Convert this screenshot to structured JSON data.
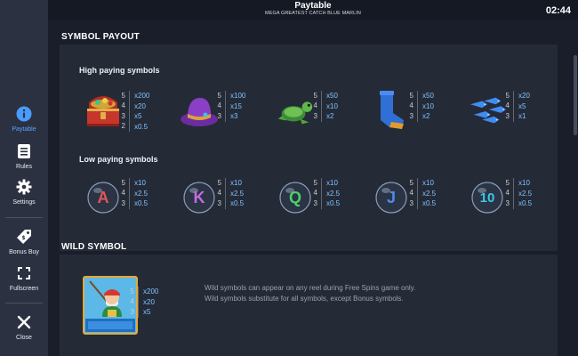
{
  "header": {
    "title": "Paytable",
    "subtitle": "MEGA GREATEST CATCH BLUE MARLIN",
    "clock": "02:44"
  },
  "sidebar": {
    "items": [
      {
        "label": "Paytable",
        "icon": "info-icon"
      },
      {
        "label": "Rules",
        "icon": "rules-icon"
      },
      {
        "label": "Settings",
        "icon": "gear-icon"
      },
      {
        "label": "Bonus Buy",
        "icon": "tag-icon"
      },
      {
        "label": "Fullscreen",
        "icon": "fullscreen-icon"
      },
      {
        "label": "Close",
        "icon": "close-icon"
      }
    ],
    "active_color": "#5aa6ff"
  },
  "symbol_payout": {
    "title": "SYMBOL PAYOUT",
    "high_title": "High paying symbols",
    "low_title": "Low paying symbols",
    "high": [
      {
        "icon": "treasure-chest-icon",
        "pays": [
          [
            "5",
            "x200"
          ],
          [
            "4",
            "x20"
          ],
          [
            "3",
            "x5"
          ],
          [
            "2",
            "x0.5"
          ]
        ]
      },
      {
        "icon": "fishing-hat-icon",
        "pays": [
          [
            "5",
            "x100"
          ],
          [
            "4",
            "x15"
          ],
          [
            "3",
            "x3"
          ]
        ]
      },
      {
        "icon": "turtle-icon",
        "pays": [
          [
            "5",
            "x50"
          ],
          [
            "4",
            "x10"
          ],
          [
            "3",
            "x2"
          ]
        ]
      },
      {
        "icon": "rubber-boot-icon",
        "pays": [
          [
            "5",
            "x50"
          ],
          [
            "4",
            "x10"
          ],
          [
            "3",
            "x2"
          ]
        ]
      },
      {
        "icon": "fish-school-icon",
        "pays": [
          [
            "5",
            "x20"
          ],
          [
            "4",
            "x5"
          ],
          [
            "3",
            "x1"
          ]
        ]
      }
    ],
    "low": [
      {
        "icon": "bubble-a-icon",
        "letter": "A",
        "color": "#e8545a",
        "pays": [
          [
            "5",
            "x10"
          ],
          [
            "4",
            "x2.5"
          ],
          [
            "3",
            "x0.5"
          ]
        ]
      },
      {
        "icon": "bubble-k-icon",
        "letter": "K",
        "color": "#c46be0",
        "pays": [
          [
            "5",
            "x10"
          ],
          [
            "4",
            "x2.5"
          ],
          [
            "3",
            "x0.5"
          ]
        ]
      },
      {
        "icon": "bubble-q-icon",
        "letter": "Q",
        "color": "#4fcf6a",
        "pays": [
          [
            "5",
            "x10"
          ],
          [
            "4",
            "x2.5"
          ],
          [
            "3",
            "x0.5"
          ]
        ]
      },
      {
        "icon": "bubble-j-icon",
        "letter": "J",
        "color": "#4f8be8",
        "pays": [
          [
            "5",
            "x10"
          ],
          [
            "4",
            "x2.5"
          ],
          [
            "3",
            "x0.5"
          ]
        ]
      },
      {
        "icon": "bubble-10-icon",
        "letter": "10",
        "color": "#3fc6e6",
        "pays": [
          [
            "5",
            "x10"
          ],
          [
            "4",
            "x2.5"
          ],
          [
            "3",
            "x0.5"
          ]
        ]
      }
    ]
  },
  "wild": {
    "title": "WILD SYMBOL",
    "icon": "fisherman-wild-icon",
    "pays": [
      [
        "5",
        "x200"
      ],
      [
        "4",
        "x20"
      ],
      [
        "3",
        "x5"
      ]
    ],
    "text_line1": "Wild symbols can appear on any reel during Free Spins game only.",
    "text_line2": "Wild symbols substitute for all symbols, except Bonus symbols."
  }
}
